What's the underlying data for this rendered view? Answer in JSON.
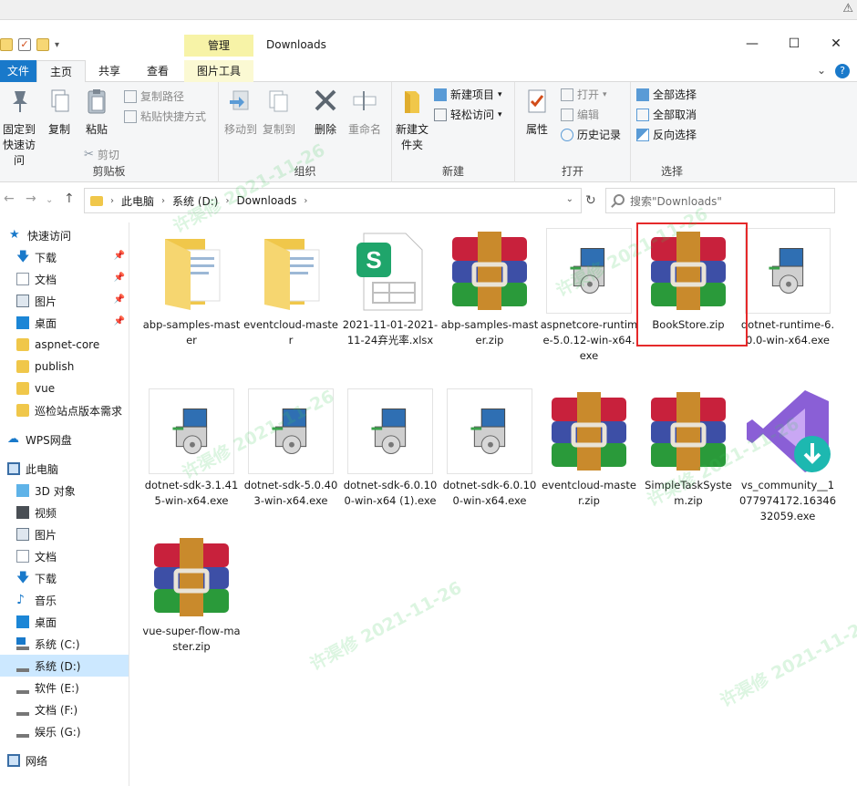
{
  "window": {
    "title": "Downloads",
    "context_tab": "管理"
  },
  "tabs": {
    "file": "文件",
    "home": "主页",
    "share": "共享",
    "view": "查看",
    "picture_tools": "图片工具"
  },
  "ribbon": {
    "clipboard": {
      "label": "剪贴板",
      "pin": "固定到快速访问",
      "copy": "复制",
      "paste": "粘贴",
      "copy_path": "复制路径",
      "paste_shortcut": "粘贴快捷方式",
      "cut": "剪切"
    },
    "organize": {
      "label": "组织",
      "move_to": "移动到",
      "copy_to": "复制到",
      "delete": "删除",
      "rename": "重命名"
    },
    "new": {
      "label": "新建",
      "new_folder": "新建文件夹",
      "new_item": "新建项目",
      "easy_access": "轻松访问"
    },
    "open": {
      "label": "打开",
      "properties": "属性",
      "open": "打开",
      "edit": "编辑",
      "history": "历史记录"
    },
    "select": {
      "label": "选择",
      "select_all": "全部选择",
      "select_none": "全部取消",
      "invert": "反向选择"
    }
  },
  "address": {
    "crumbs": [
      "此电脑",
      "系统 (D:)",
      "Downloads"
    ],
    "search_placeholder": "搜索\"Downloads\""
  },
  "nav": {
    "quick_access": "快速访问",
    "quick_items": [
      "下载",
      "文档",
      "图片",
      "桌面",
      "aspnet-core",
      "publish",
      "vue",
      "巡检站点版本需求"
    ],
    "wps": "WPS网盘",
    "this_pc": "此电脑",
    "pc_items": [
      "3D 对象",
      "视频",
      "图片",
      "文档",
      "下载",
      "音乐",
      "桌面",
      "系统 (C:)",
      "系统 (D:)",
      "软件 (E:)",
      "文档 (F:)",
      "娱乐 (G:)"
    ],
    "network": "网络"
  },
  "files": [
    {
      "name": "abp-samples-master",
      "icon": "folder-icon"
    },
    {
      "name": "eventcloud-master",
      "icon": "folder-icon"
    },
    {
      "name": "2021-11-01-2021-11-24弃光率.xlsx",
      "icon": "wps-sheet-icon"
    },
    {
      "name": "abp-samples-master.zip",
      "icon": "winrar-icon"
    },
    {
      "name": "aspnetcore-runtime-5.0.12-win-x64.exe",
      "icon": "installer-icon"
    },
    {
      "name": "BookStore.zip",
      "icon": "winrar-icon"
    },
    {
      "name": "dotnet-runtime-6.0.0-win-x64.exe",
      "icon": "installer-icon"
    },
    {
      "name": "dotnet-sdk-3.1.415-win-x64.exe",
      "icon": "installer-icon"
    },
    {
      "name": "dotnet-sdk-5.0.403-win-x64.exe",
      "icon": "installer-icon"
    },
    {
      "name": "dotnet-sdk-6.0.100-win-x64 (1).exe",
      "icon": "installer-icon"
    },
    {
      "name": "dotnet-sdk-6.0.100-win-x64.exe",
      "icon": "installer-icon"
    },
    {
      "name": "eventcloud-master.zip",
      "icon": "winrar-icon"
    },
    {
      "name": "SimpleTaskSystem.zip",
      "icon": "winrar-icon"
    },
    {
      "name": "vs_community__1077974172.1634632059.exe",
      "icon": "visual-studio-icon"
    },
    {
      "name": "vue-super-flow-master.zip",
      "icon": "winrar-icon"
    }
  ],
  "watermark": "许渠修 2021-11-26",
  "colors": {
    "accent": "#1979ca",
    "highlight": "#e5292a",
    "folder": "#f0c74a",
    "selection": "#cce8ff"
  }
}
